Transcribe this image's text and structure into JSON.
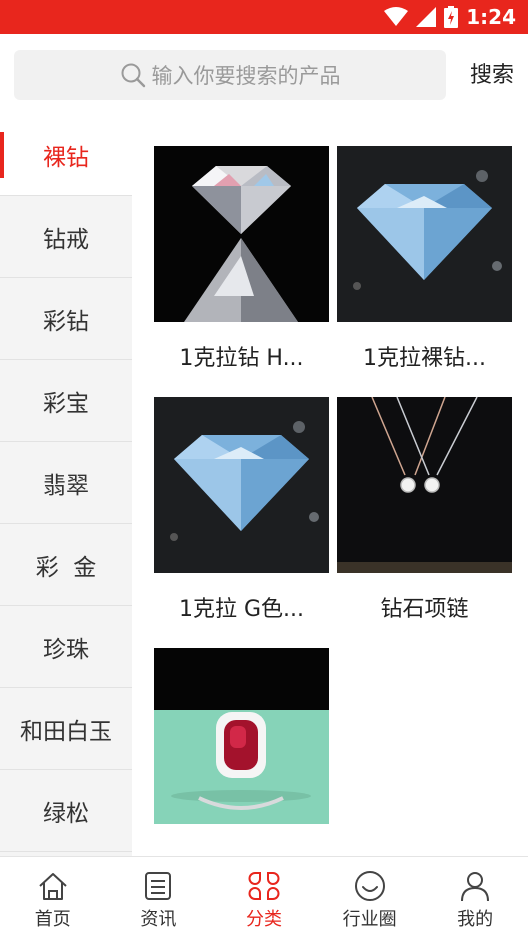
{
  "status_bar": {
    "time": "1:24",
    "color": "#e8261d"
  },
  "search": {
    "placeholder": "输入你要搜索的产品",
    "button_label": "搜索"
  },
  "sidebar": {
    "items": [
      {
        "label": "裸钻",
        "active": true
      },
      {
        "label": "钻戒"
      },
      {
        "label": "彩钻"
      },
      {
        "label": "彩宝"
      },
      {
        "label": "翡翠"
      },
      {
        "label": "彩  金"
      },
      {
        "label": "珍珠"
      },
      {
        "label": "和田白玉"
      },
      {
        "label": "绿松"
      }
    ]
  },
  "products": [
    {
      "name": "1克拉钻 H...",
      "image": "brilliant-diamond-image"
    },
    {
      "name": "1克拉裸钻...",
      "image": "blue-diamond-image"
    },
    {
      "name": "1克拉 G色...",
      "image": "blue-diamond-image"
    },
    {
      "name": "钻石项链",
      "image": "diamond-necklace-image"
    },
    {
      "name": "",
      "image": "ruby-ring-image"
    }
  ],
  "bottom_nav": {
    "items": [
      {
        "label": "首页",
        "icon": "home-icon"
      },
      {
        "label": "资讯",
        "icon": "news-icon"
      },
      {
        "label": "分类",
        "icon": "category-icon",
        "active": true
      },
      {
        "label": "行业圈",
        "icon": "circle-smile-icon"
      },
      {
        "label": "我的",
        "icon": "profile-icon"
      }
    ]
  },
  "colors": {
    "accent": "#e8261d",
    "sidebar_bg": "#f4f4f4",
    "search_bg": "#f1f1f1"
  }
}
